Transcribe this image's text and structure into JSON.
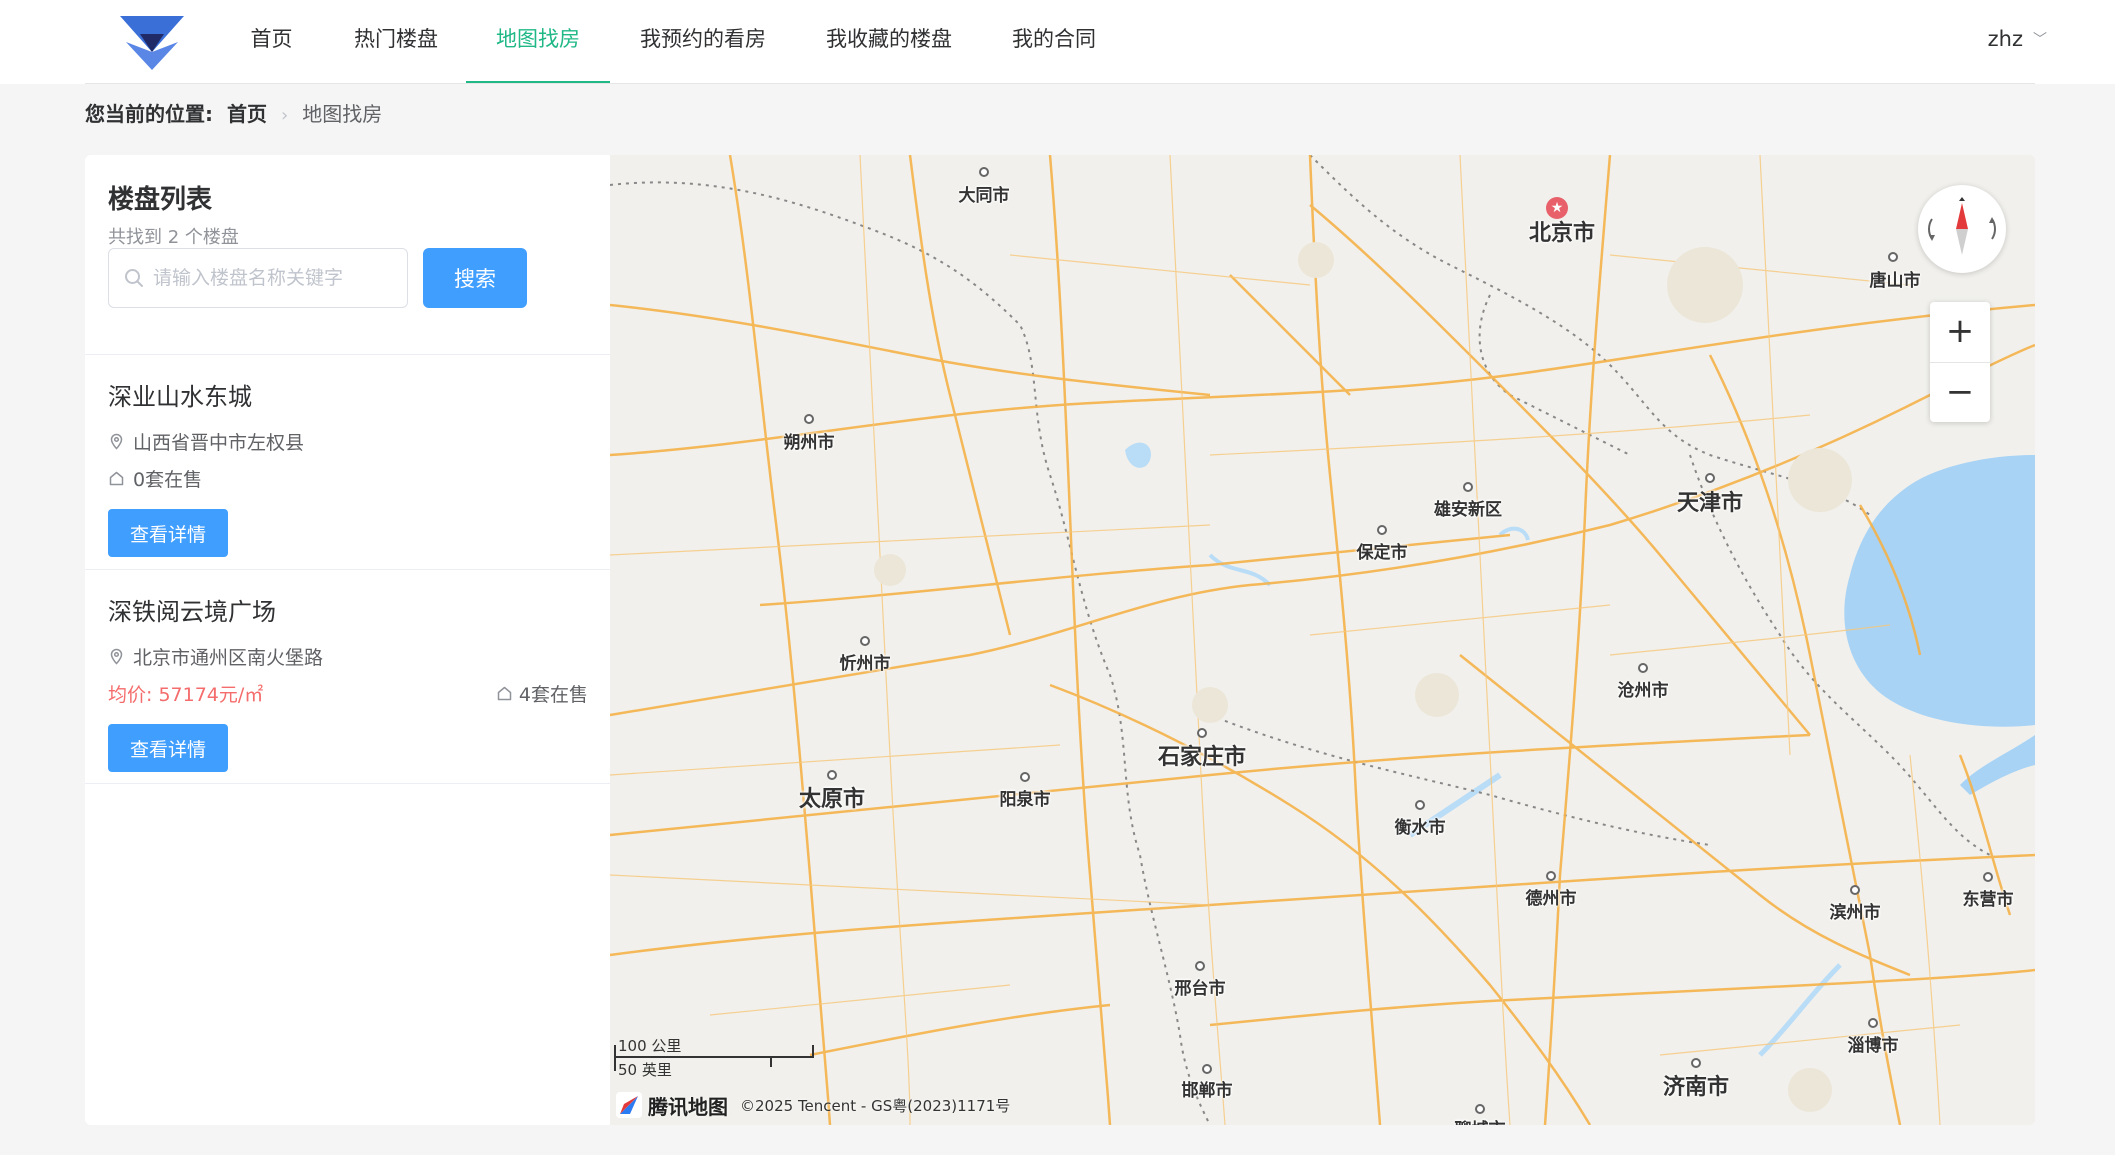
{
  "header": {
    "nav": [
      {
        "label": "首页",
        "name": "nav-home"
      },
      {
        "label": "热门楼盘",
        "name": "nav-hot-properties"
      },
      {
        "label": "地图找房",
        "name": "nav-map-search",
        "active": true
      },
      {
        "label": "我预约的看房",
        "name": "nav-my-appointments"
      },
      {
        "label": "我收藏的楼盘",
        "name": "nav-my-favorites"
      },
      {
        "label": "我的合同",
        "name": "nav-my-contracts"
      }
    ],
    "user": "zhz",
    "accent_color": "#20b887"
  },
  "breadcrumb": {
    "label": "您当前的位置:",
    "home": "首页",
    "current": "地图找房"
  },
  "panel": {
    "title": "楼盘列表",
    "count_text": "共找到 2 个楼盘",
    "search_placeholder": "请输入楼盘名称关键字",
    "search_button": "搜索",
    "primary_color": "#409eff",
    "price_color": "#f56c6c",
    "properties": [
      {
        "name": "深业山水东城",
        "address": "山西省晋中市左权县",
        "stock": "0套在售",
        "detail_button": "查看详情"
      },
      {
        "name": "深铁阅云境广场",
        "address": "北京市通州区南火堡路",
        "price": "均价: 57174元/㎡",
        "stock": "4套在售",
        "detail_button": "查看详情"
      }
    ]
  },
  "map": {
    "cities": [
      {
        "name": "北京市",
        "big": true
      },
      {
        "name": "大同市"
      },
      {
        "name": "唐山市"
      },
      {
        "name": "朔州市"
      },
      {
        "name": "雄安新区"
      },
      {
        "name": "天津市",
        "big": true
      },
      {
        "name": "保定市"
      },
      {
        "name": "忻州市"
      },
      {
        "name": "沧州市"
      },
      {
        "name": "石家庄市",
        "big": true
      },
      {
        "name": "太原市",
        "big": true
      },
      {
        "name": "阳泉市"
      },
      {
        "name": "衡水市"
      },
      {
        "name": "德州市"
      },
      {
        "name": "滨州市"
      },
      {
        "name": "东营市"
      },
      {
        "name": "邢台市"
      },
      {
        "name": "淄博市"
      },
      {
        "name": "邯郸市"
      },
      {
        "name": "济南市",
        "big": true
      },
      {
        "name": "聊城市"
      }
    ],
    "scale_km": "100 公里",
    "scale_mi": "50 英里",
    "brand": "腾讯地图",
    "copyright": "©2025 Tencent - GS粤(2023)1171号",
    "zoom_in": "+",
    "zoom_out": "−",
    "water_color": "#a8d3f5",
    "road_color": "#f5b24a"
  }
}
